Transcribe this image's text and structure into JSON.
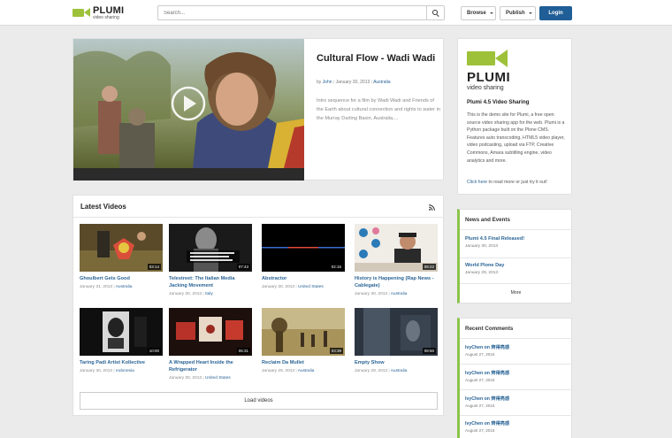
{
  "header": {
    "logo_name": "PLUMI",
    "logo_sub": "video sharing",
    "search_placeholder": "Search...",
    "browse_label": "Browse",
    "publish_label": "Publish",
    "login_label": "Login"
  },
  "featured": {
    "title": "Cultural Flow - Wadi Wadi",
    "by": "by",
    "author": "John",
    "date": "January 30, 2013",
    "location": "Australia",
    "description": "Intro sequence for a film by Wadi Wadi and Friends of the Earth about cultural connection and rights to water in the Murray Darling Basin, Australia,..."
  },
  "latest": {
    "heading": "Latest Videos",
    "load_label": "Load videos",
    "videos": [
      {
        "title": "Ghoulbert Gets Good",
        "date": "January 31, 2013",
        "location": "Australia",
        "duration": "03:14"
      },
      {
        "title": "Telestreet: The Italian Media Jacking Movement",
        "date": "January 30, 2013",
        "location": "Italy",
        "duration": "07:43"
      },
      {
        "title": "Abstractor",
        "date": "January 30, 2013",
        "location": "United States",
        "duration": "02:15"
      },
      {
        "title": "History is Happening (Rap News - Cablegate)",
        "date": "January 30, 2013",
        "location": "Australia",
        "duration": "08:22"
      },
      {
        "title": "Taring Padi Artist Kollective",
        "date": "January 30, 2013",
        "location": "Indonesia",
        "duration": "10:00"
      },
      {
        "title": "A Wrapped Heart Inside the Refrigerator",
        "date": "January 30, 2013",
        "location": "United States",
        "duration": "06:31"
      },
      {
        "title": "Reclaim Da Mullet",
        "date": "January 29, 2013",
        "location": "Australia",
        "duration": "03:39"
      },
      {
        "title": "Empty Show",
        "date": "January 29, 2013",
        "location": "Australia",
        "duration": "08:50"
      }
    ]
  },
  "about": {
    "logo_name": "PLUMI",
    "logo_sub": "video sharing",
    "title": "Plumi 4.5 Video Sharing",
    "description": "This is the demo site for Plumi, a free open source video sharing app for the web. Plumi is a Python package built on the Plone CMS. Features auto transcoding, HTML5 video player, video podcasting, upload via FTP, Creative Commons, Amara subtitling engine, video analytics and more.",
    "click_here": "Click here",
    "more_text": " to read more or just try it out!"
  },
  "news": {
    "heading": "News and Events",
    "items": [
      {
        "title": "Plumi 4.5 Final Released!",
        "date": "January 30, 2013"
      },
      {
        "title": "World Plone Day",
        "date": "January 29, 2013"
      }
    ],
    "more_label": "More"
  },
  "comments": {
    "heading": "Recent Comments",
    "items": [
      {
        "user": "IvyChen",
        "on": " on ",
        "target": "齊得亮感",
        "date": "August 27, 2015"
      },
      {
        "user": "IvyChen",
        "on": " on ",
        "target": "齊得亮感",
        "date": "August 27, 2015"
      },
      {
        "user": "IvyChen",
        "on": " on ",
        "target": "齊得亮感",
        "date": "August 27, 2015"
      },
      {
        "user": "IvyChen",
        "on": " on ",
        "target": "齊得亮感",
        "date": "August 27, 2015"
      }
    ]
  },
  "colors": {
    "brand_green": "#9ec13a",
    "login_blue": "#1f5e96",
    "link_blue": "#2a6496",
    "accent_border": "#8bc34a"
  }
}
